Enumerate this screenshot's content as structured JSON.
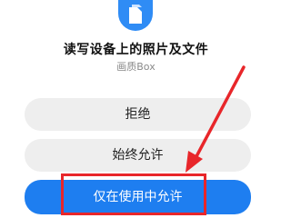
{
  "dialog": {
    "title": "读写设备上的照片及文件",
    "app_name": "画质Box",
    "icon": "document-icon",
    "buttons": {
      "deny": "拒绝",
      "allow_always": "始终允许",
      "allow_while_using": "仅在使用中允许"
    }
  },
  "annotation": {
    "color": "#e8262a"
  },
  "colors": {
    "accent": "#1e7ef0",
    "icon_bg": "#2f8cf5",
    "secondary_button_bg": "#eeeeee"
  }
}
